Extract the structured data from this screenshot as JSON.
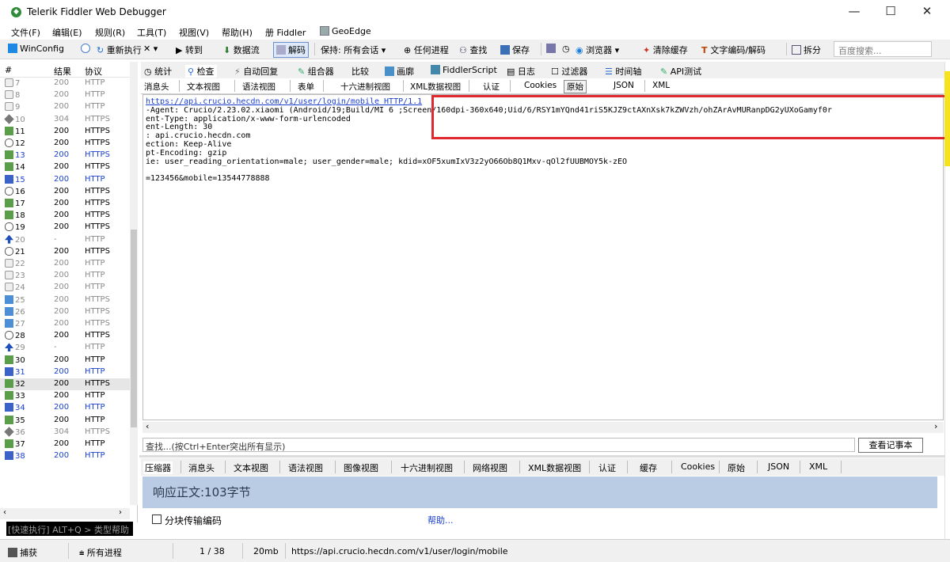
{
  "window": {
    "title": "Telerik Fiddler Web Debugger",
    "minimize": "—",
    "maximize": "☐",
    "close": "✕"
  },
  "menu": [
    "文件(F)",
    "编辑(E)",
    "规则(R)",
    "工具(T)",
    "视图(V)",
    "帮助(H)",
    "册 Fiddler",
    "GeoEdge"
  ],
  "toolbar": {
    "winconfig": "WinConfig",
    "replay": "重新执行",
    "remove": "✕ ▾",
    "go": "▶ 转到",
    "stream": "数据流",
    "decode": "解码",
    "keep": "保持: 所有会话 ▾",
    "any_process": "任何进程",
    "find": "查找",
    "save": "保存",
    "browse": "浏览器 ▾",
    "clear_cache": "清除缓存",
    "text_encode": "文字编码/解码",
    "tearoff": "拆分",
    "search_placeholder": "百度搜索..."
  },
  "sessions": {
    "headers": [
      "#",
      "结果",
      "协议"
    ],
    "rows": [
      {
        "num": "7",
        "result": "200",
        "protocol": "HTTP",
        "icon": "lock-icon",
        "style": "gray"
      },
      {
        "num": "8",
        "result": "200",
        "protocol": "HTTP",
        "icon": "lock-icon",
        "style": "gray"
      },
      {
        "num": "9",
        "result": "200",
        "protocol": "HTTP",
        "icon": "lock-icon",
        "style": "gray"
      },
      {
        "num": "10",
        "result": "304",
        "protocol": "HTTPS",
        "icon": "diamond-icon",
        "style": "gray"
      },
      {
        "num": "11",
        "result": "200",
        "protocol": "HTTPS",
        "icon": "response-icon",
        "style": "black"
      },
      {
        "num": "12",
        "result": "200",
        "protocol": "HTTPS",
        "icon": "json-icon",
        "style": "black"
      },
      {
        "num": "13",
        "result": "200",
        "protocol": "HTTPS",
        "icon": "response-icon",
        "style": "blue"
      },
      {
        "num": "14",
        "result": "200",
        "protocol": "HTTPS",
        "icon": "response-icon",
        "style": "black"
      },
      {
        "num": "15",
        "result": "200",
        "protocol": "HTTP",
        "icon": "script-icon",
        "style": "blue"
      },
      {
        "num": "16",
        "result": "200",
        "protocol": "HTTPS",
        "icon": "json-icon",
        "style": "black"
      },
      {
        "num": "17",
        "result": "200",
        "protocol": "HTTPS",
        "icon": "response-icon",
        "style": "black"
      },
      {
        "num": "18",
        "result": "200",
        "protocol": "HTTPS",
        "icon": "response-icon",
        "style": "black"
      },
      {
        "num": "19",
        "result": "200",
        "protocol": "HTTPS",
        "icon": "json-icon",
        "style": "black"
      },
      {
        "num": "20",
        "result": "-",
        "protocol": "HTTP",
        "icon": "upload-icon",
        "style": "gray"
      },
      {
        "num": "21",
        "result": "200",
        "protocol": "HTTPS",
        "icon": "json-icon",
        "style": "black"
      },
      {
        "num": "22",
        "result": "200",
        "protocol": "HTTP",
        "icon": "lock-icon",
        "style": "gray"
      },
      {
        "num": "23",
        "result": "200",
        "protocol": "HTTP",
        "icon": "lock-icon",
        "style": "gray"
      },
      {
        "num": "24",
        "result": "200",
        "protocol": "HTTP",
        "icon": "lock-icon",
        "style": "gray"
      },
      {
        "num": "25",
        "result": "200",
        "protocol": "HTTPS",
        "icon": "image-icon",
        "style": "gray"
      },
      {
        "num": "26",
        "result": "200",
        "protocol": "HTTPS",
        "icon": "image-icon",
        "style": "gray"
      },
      {
        "num": "27",
        "result": "200",
        "protocol": "HTTPS",
        "icon": "image-icon",
        "style": "gray"
      },
      {
        "num": "28",
        "result": "200",
        "protocol": "HTTPS",
        "icon": "json-icon",
        "style": "black"
      },
      {
        "num": "29",
        "result": "-",
        "protocol": "HTTP",
        "icon": "upload-icon",
        "style": "gray"
      },
      {
        "num": "30",
        "result": "200",
        "protocol": "HTTP",
        "icon": "response-icon",
        "style": "black"
      },
      {
        "num": "31",
        "result": "200",
        "protocol": "HTTP",
        "icon": "script-icon",
        "style": "blue"
      },
      {
        "num": "32",
        "result": "200",
        "protocol": "HTTPS",
        "icon": "response-icon",
        "style": "selected"
      },
      {
        "num": "33",
        "result": "200",
        "protocol": "HTTP",
        "icon": "response-icon",
        "style": "black"
      },
      {
        "num": "34",
        "result": "200",
        "protocol": "HTTP",
        "icon": "script-icon",
        "style": "blue"
      },
      {
        "num": "35",
        "result": "200",
        "protocol": "HTTP",
        "icon": "response-icon",
        "style": "black"
      },
      {
        "num": "36",
        "result": "304",
        "protocol": "HTTPS",
        "icon": "diamond-icon",
        "style": "gray"
      },
      {
        "num": "37",
        "result": "200",
        "protocol": "HTTP",
        "icon": "response-icon",
        "style": "black"
      },
      {
        "num": "38",
        "result": "200",
        "protocol": "HTTP",
        "icon": "script-icon",
        "style": "blue"
      }
    ],
    "quickexec": "[快速执行] ALT+Q > 类型帮助"
  },
  "inspector_tabs": [
    "统计",
    "检查",
    "自动回复",
    "组合器",
    "比较",
    "画廓",
    "FiddlerScript",
    "日志",
    "过滤器",
    "时间轴",
    "API测试"
  ],
  "request_tabs": [
    "消息头",
    "文本视图",
    "语法视图",
    "表单",
    "十六进制视图",
    "XML数据视图",
    "认证",
    "Cookies",
    "原始",
    "JSON",
    "XML"
  ],
  "request": {
    "url_line": "https://api.crucio.hecdn.com/v1/user/login/mobile HTTP/1.1",
    "lines": [
      "-Agent: Crucio/2.23.02.xiaomi (Android/19;Build/MI 6 ;Screen/160dpi-360x640;Uid/6/RSY1mYQnd41riS5KJZ9ctAXnXsk7kZWVzh/ohZArAvMURanpDG2yUXoGamyf0r",
      "ent-Type: application/x-www-form-urlencoded",
      "ent-Length: 30",
      ": api.crucio.hecdn.com",
      "ection: Keep-Alive",
      "pt-Encoding: gzip",
      "ie: user_reading_orientation=male; user_gender=male; kdid=xOF5xumIxV3z2yO66Ob8Q1Mxv-qOl2fUUBMOY5k-zEO",
      "",
      "=123456&mobile=13544778888"
    ]
  },
  "find": {
    "placeholder": "查找...(按Ctrl+Enter突出所有显示)",
    "notepad": "查看记事本"
  },
  "response_tabs": [
    "压缩器",
    "消息头",
    "文本视图",
    "语法视图",
    "图像视图",
    "十六进制视图",
    "网络视图",
    "XML数据视图",
    "认证",
    "缓存",
    "Cookies",
    "原始",
    "JSON",
    "XML"
  ],
  "response": {
    "banner": "响应正文:103字节",
    "chunked": "分块传输编码",
    "help": "帮助..."
  },
  "status": {
    "capture": "捕获",
    "process": "所有进程",
    "count": "1 / 38",
    "size": "20mb",
    "url": "https://api.crucio.hecdn.com/v1/user/login/mobile"
  },
  "colors": {
    "highlight": "#e0282f",
    "banner": "#b9cce3",
    "link": "#1a3fd0"
  }
}
